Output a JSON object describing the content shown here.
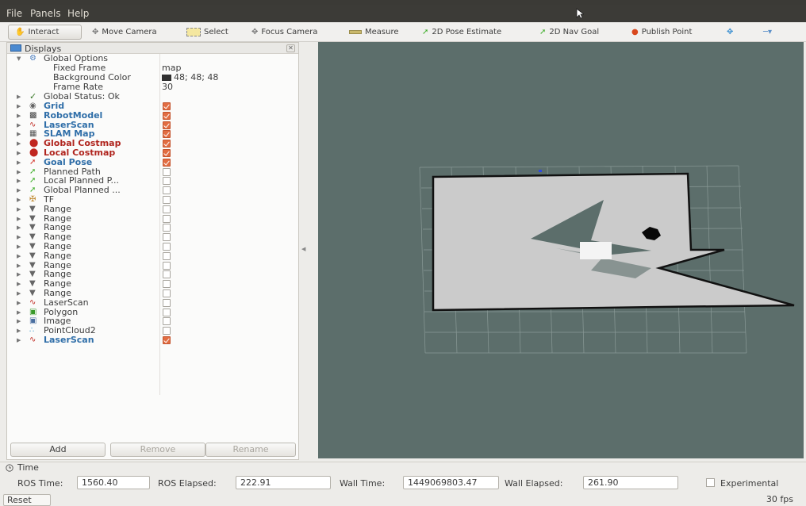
{
  "menu": {
    "file": "File",
    "panels": "Panels",
    "help": "Help"
  },
  "toolbar": {
    "interact": "Interact",
    "move_camera": "Move Camera",
    "select": "Select",
    "focus_camera": "Focus Camera",
    "measure": "Measure",
    "pose_estimate": "2D Pose Estimate",
    "nav_goal": "2D Nav Goal",
    "publish_point": "Publish Point"
  },
  "displays": {
    "title": "Displays",
    "global_options": "Global Options",
    "fixed_frame_label": "Fixed Frame",
    "fixed_frame_value": "map",
    "bg_color_label": "Background Color",
    "bg_color_value": "48; 48; 48",
    "frame_rate_label": "Frame Rate",
    "frame_rate_value": "30",
    "global_status": "Global Status: Ok",
    "items": [
      {
        "label": "Grid",
        "style": "blue",
        "checked": true,
        "icon": "grid-icon"
      },
      {
        "label": "RobotModel",
        "style": "blue",
        "checked": true,
        "icon": "robot-model-icon"
      },
      {
        "label": "LaserScan",
        "style": "blue",
        "checked": true,
        "icon": "laser-scan-icon"
      },
      {
        "label": "SLAM Map",
        "style": "blue",
        "checked": true,
        "icon": "map-icon"
      },
      {
        "label": "Global Costmap",
        "style": "red",
        "checked": true,
        "icon": "costmap-icon"
      },
      {
        "label": "Local Costmap",
        "style": "red",
        "checked": true,
        "icon": "costmap-icon"
      },
      {
        "label": "Goal Pose",
        "style": "blue",
        "checked": true,
        "icon": "pose-icon"
      },
      {
        "label": "Planned Path",
        "style": "",
        "checked": false,
        "icon": "path-icon"
      },
      {
        "label": "Local Planned P...",
        "style": "",
        "checked": false,
        "icon": "path-icon"
      },
      {
        "label": "Global Planned ...",
        "style": "",
        "checked": false,
        "icon": "path-icon"
      },
      {
        "label": "TF",
        "style": "",
        "checked": false,
        "icon": "tf-icon"
      },
      {
        "label": "Range",
        "style": "",
        "checked": false,
        "icon": "range-icon"
      },
      {
        "label": "Range",
        "style": "",
        "checked": false,
        "icon": "range-icon"
      },
      {
        "label": "Range",
        "style": "",
        "checked": false,
        "icon": "range-icon"
      },
      {
        "label": "Range",
        "style": "",
        "checked": false,
        "icon": "range-icon"
      },
      {
        "label": "Range",
        "style": "",
        "checked": false,
        "icon": "range-icon"
      },
      {
        "label": "Range",
        "style": "",
        "checked": false,
        "icon": "range-icon"
      },
      {
        "label": "Range",
        "style": "",
        "checked": false,
        "icon": "range-icon"
      },
      {
        "label": "Range",
        "style": "",
        "checked": false,
        "icon": "range-icon"
      },
      {
        "label": "Range",
        "style": "",
        "checked": false,
        "icon": "range-icon"
      },
      {
        "label": "Range",
        "style": "",
        "checked": false,
        "icon": "range-icon"
      },
      {
        "label": "LaserScan",
        "style": "",
        "checked": false,
        "icon": "laser-scan-icon"
      },
      {
        "label": "Polygon",
        "style": "",
        "checked": false,
        "icon": "polygon-icon"
      },
      {
        "label": "Image",
        "style": "",
        "checked": false,
        "icon": "image-icon"
      },
      {
        "label": "PointCloud2",
        "style": "",
        "checked": false,
        "icon": "point-cloud-icon"
      },
      {
        "label": "LaserScan",
        "style": "blue",
        "checked": true,
        "icon": "laser-scan-icon"
      }
    ],
    "add": "Add",
    "remove": "Remove",
    "rename": "Rename"
  },
  "time": {
    "title": "Time",
    "ros_time_label": "ROS Time:",
    "ros_time_value": "1560.40",
    "ros_elapsed_label": "ROS Elapsed:",
    "ros_elapsed_value": "222.91",
    "wall_time_label": "Wall Time:",
    "wall_time_value": "1449069803.47",
    "wall_elapsed_label": "Wall Elapsed:",
    "wall_elapsed_value": "261.90",
    "experimental": "Experimental",
    "reset": "Reset",
    "fps": "30 fps"
  },
  "colors": {
    "checked": "#e26d42",
    "viewport_bg": "#5c6e6b",
    "map_free": "#cbcbcb",
    "blue_label": "#2f6ea8",
    "red_label": "#b0251e"
  }
}
